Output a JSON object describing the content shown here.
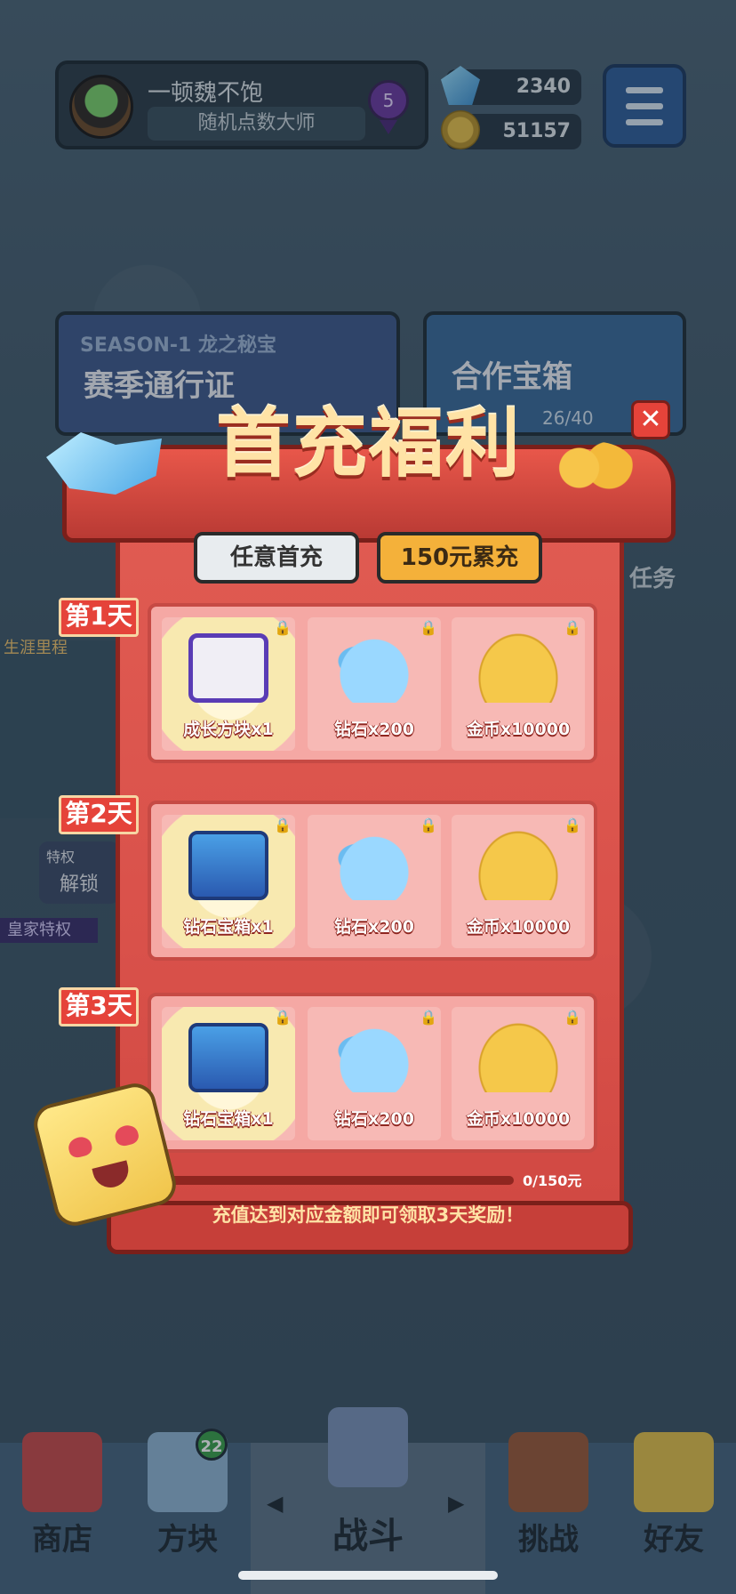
{
  "profile": {
    "name": "一顿魏不饱",
    "title": "随机点数大师",
    "medal_level": "5"
  },
  "resources": {
    "gems": "2340",
    "coins": "51157"
  },
  "background": {
    "season_tag": "SEASON-1 龙之秘宝",
    "season_pass": "赛季通行证",
    "coop_chest": "合作宝箱",
    "coop_progress": "26/40",
    "task_label": "任务",
    "career_label": "生涯里程",
    "privilege_label": "特权",
    "unlock_label": "解锁",
    "royal_label": "皇家特权"
  },
  "modal": {
    "title": "首充福利",
    "close": "✕",
    "tabs": [
      "任意首充",
      "150元累充"
    ],
    "lock_glyph": "🔒",
    "days": [
      {
        "tag": "第1天",
        "rewards": [
          {
            "name": "成长方块x1",
            "icon": "growth-cube"
          },
          {
            "name": "钻石x200",
            "icon": "diamond"
          },
          {
            "name": "金币x10000",
            "icon": "coin"
          }
        ]
      },
      {
        "tag": "第2天",
        "rewards": [
          {
            "name": "钻石宝箱x1",
            "icon": "diamond-chest"
          },
          {
            "name": "钻石x200",
            "icon": "diamond"
          },
          {
            "name": "金币x10000",
            "icon": "coin"
          }
        ]
      },
      {
        "tag": "第3天",
        "rewards": [
          {
            "name": "钻石宝箱x1",
            "icon": "diamond-chest"
          },
          {
            "name": "钻石x200",
            "icon": "diamond"
          },
          {
            "name": "金币x10000",
            "icon": "coin"
          }
        ]
      }
    ],
    "progress_text": "0/150元",
    "progress_fraction": 0,
    "hint": "充值达到对应金额即可领取3天奖励！"
  },
  "nav": {
    "items": [
      "商店",
      "方块",
      "战斗",
      "挑战",
      "好友"
    ],
    "cube_badge": "22",
    "arrow_left": "◀",
    "arrow_right": "▶"
  }
}
